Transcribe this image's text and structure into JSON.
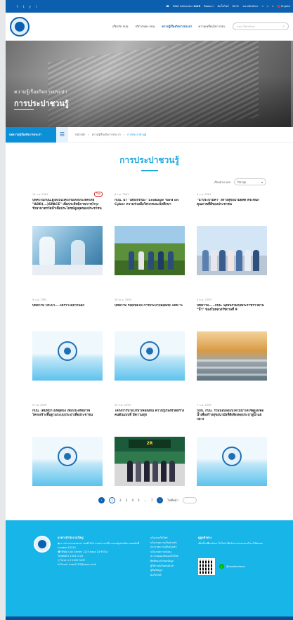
{
  "topbar": {
    "social": [
      "f",
      "t",
      "y",
      "i"
    ],
    "callcenter": "MWA Callcenter",
    "callcenter_num": "1125",
    "links": [
      "ติดต่อเรา",
      "ผังเว็บไซต์",
      "WCIC",
      "ขนาดตัวอักษร",
      "ก",
      "ก",
      "ก"
    ],
    "lang": "English"
  },
  "nav": {
    "items": [
      "เกี่ยวกับ กปน.",
      "บริการของ กปน.",
      "ความรู้เรื่องกิจการประปา",
      "ความเคลื่อนไหว กปน."
    ],
    "search_placeholder": "กรุณาใส่คำค้นหา"
  },
  "hero": {
    "subtitle": "ความรู้เรื่องกิจการประปา",
    "title": "การประปาชวนรู้"
  },
  "breadcrumb": {
    "box": "บทความรู้เรื่องกิจการประปา",
    "items": [
      "หน้าหลัก",
      "ความรู้เรื่องกิจการประปา",
      "การประปาชวนรู้"
    ]
  },
  "page": {
    "title": "การประปาชวนรู้"
  },
  "filter": {
    "label": "เรียงตาม พ.ศ.",
    "value": "ปีล่าสุด"
  },
  "cards": [
    {
      "date": "11 ก.ย. 2561",
      "tag": "ใหม่",
      "title": "บทความกปน.ผู้ใดเป็นวิศวกรแห่งประเทศไทย \"ADD(...)SPACE\" เพิ่มประสิทธิภาพการบำรุงรักษามาตรวัดน้ำเพื่อประโยชน์สูงสุดของประชาชน",
      "thumb": "lab"
    },
    {
      "date": "6 ก.ค. 2561",
      "tag": "",
      "title": "กปน. นำ \"เสียงธรรมะ\" Leakage Yard on Cyber ความร่วมมือวิศวกรและนักศึกษา",
      "thumb": "field"
    },
    {
      "date": "9 ก.ค. 2561",
      "tag": "",
      "title": "\"น้ำประปามีค่า\" สร้างสุขอนามัยที่ดี ตระหนักคุณภาพที่ดีของประชาชน",
      "thumb": "group"
    },
    {
      "date": "9 ม.ค. 2561",
      "tag": "",
      "title": "บทความ ประปา....ใครว่าไม่ยากนอก",
      "thumb": "water"
    },
    {
      "date": "28 เม.ย. 2560",
      "tag": "",
      "title": "บทความ ร้อยเปิดไฟ การประปาปลอดภัย 100 %",
      "thumb": "water"
    },
    {
      "date": "3 ส.ค. 2559",
      "tag": "",
      "title": "บทความ.....กปน. มุ่งมั่นรวมก่อพระราชร้าวีด้าน \"น้ำ\" ของในหลวงรัชกาลที่ 9",
      "thumb": "gold"
    },
    {
      "date": "5 ก.ย. 2559",
      "tag": "",
      "title": "กปน. เติมหน้าไม่หยุดนิ่ง เพิ่มประสิทธิภาพโครงสร้างพื้นฐานระบบประปาเพื่อประชาชน",
      "thumb": "water"
    },
    {
      "date": "29 ก.ค. 2559",
      "tag": "",
      "title": "โครงการนำแปรน้ำเพื่อยั่งยืน ความรู้เรื่องชีวิตสร้างคนต้นแบบที่ มีความสุข",
      "thumb": "event"
    },
    {
      "date": "7 ก.ค. 2559",
      "tag": "",
      "title": "กปน. กปน. ร่วมมอบลงแน่ใจในน้ำได้ใช้ดูแลเพื่อน้ำเพื่อสร้างสุขอนามัยที่ดีเพียงพอประปาสู่น้ำแผ่กลาง",
      "thumb": "water"
    }
  ],
  "pager": {
    "pages": [
      "1",
      "2",
      "3",
      "4",
      "5",
      "...",
      "7"
    ],
    "goto_label": "ไปที่หน้า"
  },
  "footer": {
    "org_title": "อาคารสำนักงานใหญ่",
    "address": "การประปานครหลวง เลขที่ 400 ถนนประชาชื่น แขวงทุ่งสองห้อง เขตหลักสี่ กรุงเทพฯ 10210",
    "call": "MWA Call Center 1125 ตลอด 24 ชั่วโมง",
    "call2": "โทรศัพท์ 0 2504 0123",
    "fax": "โทรสาร 0 2503 9437",
    "email": "Email: mwa1125@mwa.co.th",
    "links": [
      "นโยบายเว็บไซต์",
      "นโยบายความเป็นส่วนตัว",
      "ประกาศความเป็นส่วนตัว",
      "นโยบายความมั่นคง",
      "ความปลอดภัยของเว็บไซต์",
      "สิทธิของเจ้าของข้อมูล",
      "ผู้ใช้งานอิเล็กทรอนิกส์",
      "คู่มือ/ข้อมูล",
      "ผังเว็บไซต์"
    ],
    "contact_title": "ดูลูกค้าทาง",
    "contact_text": "เพิ่มเป็นเพื่อนกับเราในไลน์ เพื่อรับข่าวสารและบริการได้ตลอด",
    "line_label": "@mwathailand"
  }
}
